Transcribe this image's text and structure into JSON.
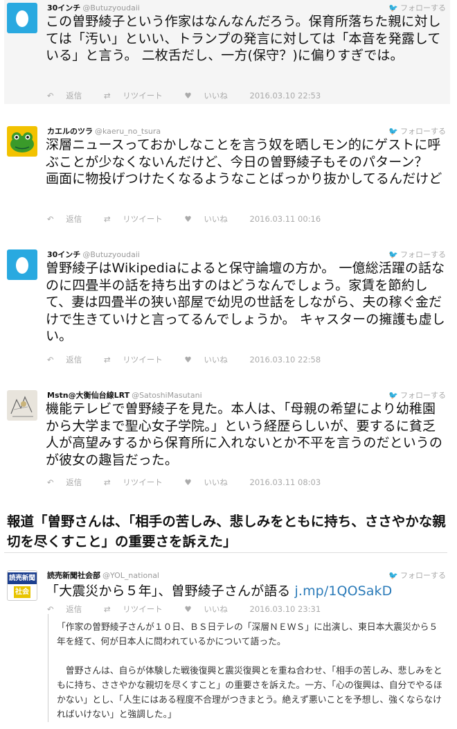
{
  "tweets": [
    {
      "name": "30インチ",
      "handle": "@Butuzyoudaii",
      "follow": "フォローする",
      "text": "この曽野綾子という作家はなんなんだろう。保育所落ちた親に対しては「汚い」といい、トランプの発言に対しては「本音を発露している」と言う。 二枚舌だし、一方(保守？)に偏りすぎでは。",
      "reply": "返信",
      "retweet": "リツイート",
      "like": "いいね",
      "date": "2016.03.10 22:53"
    },
    {
      "name": "カエルのツラ",
      "handle": "@kaeru_no_tsura",
      "follow": "フォローする",
      "text": "深層ニュースっておかしなことを言う奴を晒しモン的にゲストに呼ぶことが少なくないんだけど、今日の曽野綾子もそのパターン？　画面に物投げつけたくなるようなことばっかり抜かしてるんだけど",
      "reply": "返信",
      "retweet": "リツイート",
      "like": "いいね",
      "date": "2016.03.11 00:16"
    },
    {
      "name": "30インチ",
      "handle": "@Butuzyoudaii",
      "follow": "フォローする",
      "text": "曽野綾子はWikipediaによると保守論壇の方か。 一億総活躍の話なのに四畳半の話を持ち出すのはどうなんでしょう。家賃を節約して、妻は四畳半の狭い部屋で幼児の世話をしながら、夫の稼ぐ金だけで生きていけと言ってるんでしょうか。 キャスターの擁護も虚しい。",
      "reply": "返信",
      "retweet": "リツイート",
      "like": "いいね",
      "date": "2016.03.10 22:58"
    },
    {
      "name": "Mstn@大衡仙台線LRT",
      "handle": "@SatoshiMasutani",
      "follow": "フォローする",
      "text": "機能テレビで曽野綾子を見た。本人は、「母親の希望により幼稚園から大学まで聖心女子学院。」という経歴らしいが、要するに貧乏人が高望みするから保育所に入れないとか不平を言うのだというのが彼女の趣旨だった。",
      "reply": "返信",
      "retweet": "リツイート",
      "like": "いいね",
      "date": "2016.03.11 08:03"
    }
  ],
  "heading": "報道「曽野さんは、「相手の苦しみ、悲しみをともに持ち、ささやかな親切を尽くすこと」の重要さを訴えた」",
  "news_tweet": {
    "name": "読売新聞社会部",
    "handle": "@YOL_national",
    "follow": "フォローする",
    "avatar_line1": "読売新聞",
    "avatar_line2": "社会",
    "text": "「大震災から５年」、曽野綾子さんが語る ",
    "link": "j.mp/1QOSakD",
    "reply": "返信",
    "retweet": "リツイート",
    "like": "いいね",
    "date": "2016.03.10 23:31"
  },
  "quote": {
    "para1": "「作家の曽野綾子さんが１０日、ＢＳ日テレの「深層ＮＥＷＳ」に出演し、東日本大震災から５年を経て、何が日本人に問われているかについて語った。",
    "para2": "　曽野さんは、自らが体験した戦後復興と震災復興とを重ね合わせ、「相手の苦しみ、悲しみをともに持ち、ささやかな親切を尽くすこと」の重要さを訴えた。一方、「心の復興は、自分でやるほかない」とし、「人生にはある程度不合理がつきまとう。絶えず悪いことを予想し、強くならなければいけない」と強調した。」"
  },
  "colors": {
    "twitter_blue": "#1da1f2",
    "link": "#2b7bb9",
    "grey": "#aaaaaa"
  }
}
